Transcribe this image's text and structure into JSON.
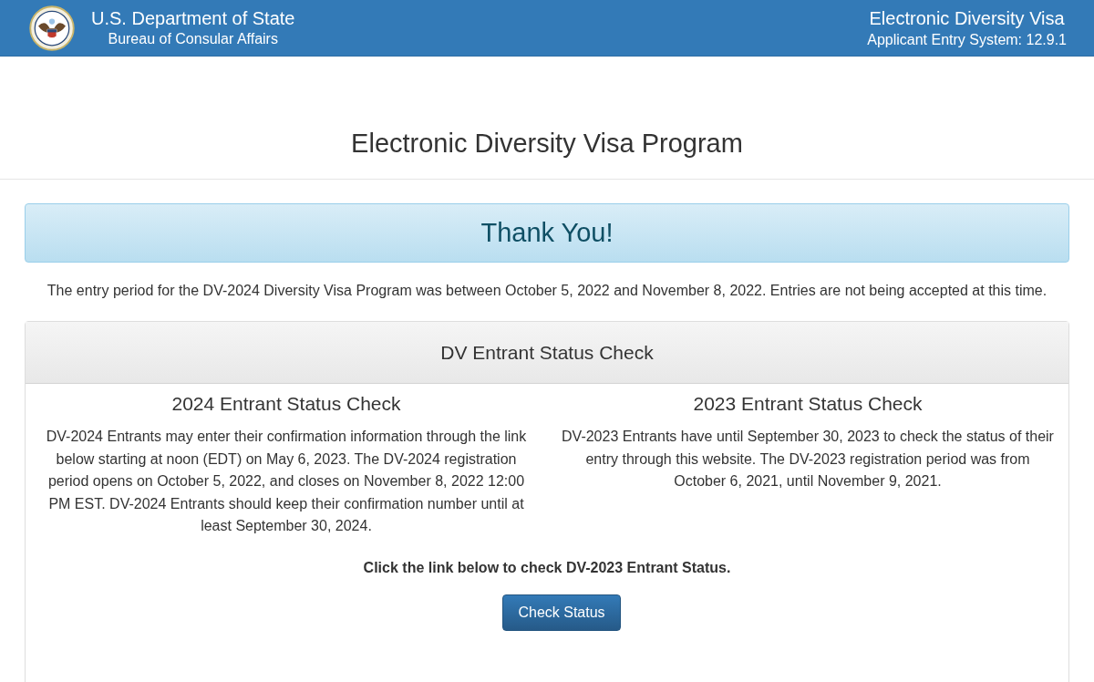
{
  "header": {
    "agency": "U.S. Department of State",
    "bureau": "Bureau of Consular Affairs",
    "system_title": "Electronic Diversity Visa",
    "system_version": "Applicant Entry System: 12.9.1"
  },
  "page_title": "Electronic Diversity Visa Program",
  "alert": {
    "title": "Thank You!"
  },
  "notice": "The entry period for the DV-2024 Diversity Visa Program was between October 5, 2022 and November 8, 2022. Entries are not being accepted at this time.",
  "panel": {
    "title": "DV Entrant Status Check",
    "columns": [
      {
        "heading": "2024 Entrant Status Check",
        "text": "DV-2024 Entrants may enter their confirmation information through the link below starting at noon (EDT) on May 6, 2023. The DV-2024 registration period opens on October 5, 2022, and closes on November 8, 2022 12:00 PM EST. DV-2024 Entrants should keep their confirmation number until at least September 30, 2024."
      },
      {
        "heading": "2023 Entrant Status Check",
        "text": "DV-2023 Entrants have until September 30, 2023 to check the status of their entry through this website. The DV-2023 registration period was from October 6, 2021, until November 9, 2021."
      }
    ],
    "instruction": "Click the link below to check DV-2023 Entrant Status.",
    "button": "Check Status"
  }
}
